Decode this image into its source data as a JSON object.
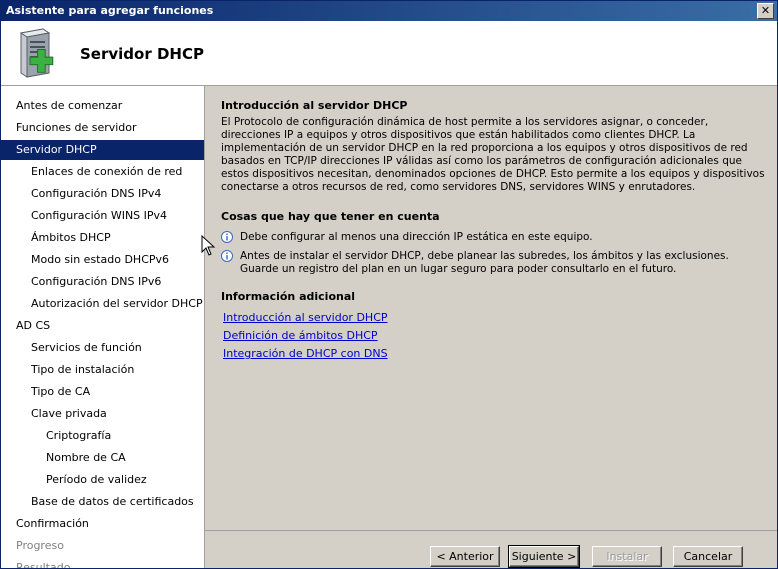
{
  "window": {
    "title": "Asistente para agregar funciones",
    "close_label": "✕"
  },
  "header": {
    "heading": "Servidor DHCP",
    "icon": "server-add-icon"
  },
  "sidebar": {
    "items": [
      {
        "label": "Antes de comenzar",
        "level": 0,
        "state": "normal"
      },
      {
        "label": "Funciones de servidor",
        "level": 0,
        "state": "normal"
      },
      {
        "label": "Servidor DHCP",
        "level": 0,
        "state": "active"
      },
      {
        "label": "Enlaces de conexión de red",
        "level": 1,
        "state": "normal"
      },
      {
        "label": "Configuración DNS IPv4",
        "level": 1,
        "state": "normal"
      },
      {
        "label": "Configuración WINS IPv4",
        "level": 1,
        "state": "normal"
      },
      {
        "label": "Ámbitos DHCP",
        "level": 1,
        "state": "normal"
      },
      {
        "label": "Modo sin estado DHCPv6",
        "level": 1,
        "state": "normal"
      },
      {
        "label": "Configuración DNS IPv6",
        "level": 1,
        "state": "normal"
      },
      {
        "label": "Autorización del servidor DHCP",
        "level": 1,
        "state": "normal"
      },
      {
        "label": "AD CS",
        "level": 0,
        "state": "normal"
      },
      {
        "label": "Servicios de función",
        "level": 1,
        "state": "normal"
      },
      {
        "label": "Tipo de instalación",
        "level": 1,
        "state": "normal"
      },
      {
        "label": "Tipo de CA",
        "level": 1,
        "state": "normal"
      },
      {
        "label": "Clave privada",
        "level": 1,
        "state": "normal"
      },
      {
        "label": "Criptografía",
        "level": 2,
        "state": "normal"
      },
      {
        "label": "Nombre de CA",
        "level": 2,
        "state": "normal"
      },
      {
        "label": "Período de validez",
        "level": 2,
        "state": "normal"
      },
      {
        "label": "Base de datos de certificados",
        "level": 1,
        "state": "normal"
      },
      {
        "label": "Confirmación",
        "level": 0,
        "state": "normal"
      },
      {
        "label": "Progreso",
        "level": 0,
        "state": "disabled"
      },
      {
        "label": "Resultado",
        "level": 0,
        "state": "disabled"
      }
    ]
  },
  "content": {
    "intro_title": "Introducción al servidor DHCP",
    "intro_text": "El Protocolo de configuración dinámica de host permite a los servidores asignar, o conceder, direcciones IP a equipos y otros dispositivos que están habilitados como clientes DHCP. La implementación de un servidor DHCP en la red proporciona a los equipos y otros dispositivos de red basados en TCP/IP direcciones IP válidas así como los parámetros de configuración adicionales que estos dispositivos necesitan, denominados opciones de DHCP. Esto permite a los equipos y dispositivos conectarse a otros recursos de red, como servidores DNS, servidores WINS y enrutadores.",
    "notes_title": "Cosas que hay que tener en cuenta",
    "notes": [
      "Debe configurar al menos una dirección IP estática en este equipo.",
      "Antes de instalar el servidor DHCP, debe planear las subredes, los ámbitos y las exclusiones. Guarde un registro del plan en un lugar seguro para poder consultarlo en el futuro."
    ],
    "more_title": "Información adicional",
    "links": [
      "Introducción al servidor DHCP",
      "Definición de ámbitos DHCP",
      "Integración de DHCP con DNS"
    ]
  },
  "footer": {
    "back": "< Anterior",
    "next": "Siguiente >",
    "install": "Instalar",
    "cancel": "Cancelar"
  }
}
